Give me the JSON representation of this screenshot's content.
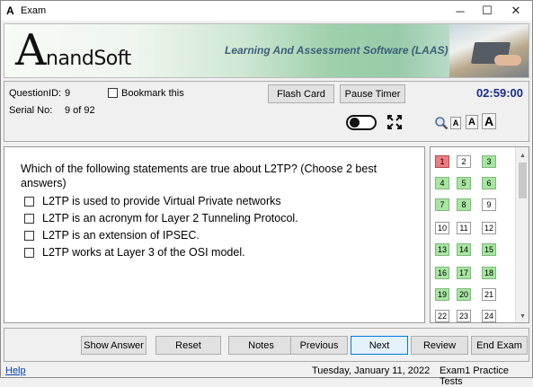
{
  "window": {
    "title": "Exam",
    "app_icon": "A",
    "controls": [
      "─",
      "☐",
      "✕"
    ]
  },
  "banner": {
    "logo_initial": "A",
    "logo_rest": "nandSoft",
    "tagline": "Learning And Assessment Software (LAAS)"
  },
  "info": {
    "question_id_label": "QuestionID:",
    "question_id": "9",
    "serial_label": "Serial No:",
    "serial": "9 of 92",
    "bookmark_label": "Bookmark this",
    "flash_card": "Flash Card",
    "pause_timer": "Pause Timer",
    "timer": "02:59:00",
    "font_sizes": [
      "A",
      "A",
      "A"
    ]
  },
  "question": {
    "text": "Which of the following statements are true about L2TP? (Choose 2 best answers)",
    "options": [
      "L2TP is used to provide Virtual Private networks",
      "L2TP is an acronym for Layer 2 Tunneling Protocol.",
      "L2TP is an extension of IPSEC.",
      "L2TP works at Layer 3 of the OSI model."
    ]
  },
  "grid": {
    "cells": [
      {
        "n": "1",
        "state": "current"
      },
      {
        "n": "2",
        "state": "none"
      },
      {
        "n": "3",
        "state": "correct"
      },
      {
        "n": "4",
        "state": "correct"
      },
      {
        "n": "5",
        "state": "correct"
      },
      {
        "n": "6",
        "state": "correct"
      },
      {
        "n": "7",
        "state": "correct"
      },
      {
        "n": "8",
        "state": "correct"
      },
      {
        "n": "9",
        "state": "none"
      },
      {
        "n": "10",
        "state": "none"
      },
      {
        "n": "11",
        "state": "none"
      },
      {
        "n": "12",
        "state": "none"
      },
      {
        "n": "13",
        "state": "correct"
      },
      {
        "n": "14",
        "state": "correct"
      },
      {
        "n": "15",
        "state": "correct"
      },
      {
        "n": "16",
        "state": "correct"
      },
      {
        "n": "17",
        "state": "correct"
      },
      {
        "n": "18",
        "state": "correct"
      },
      {
        "n": "19",
        "state": "correct"
      },
      {
        "n": "20",
        "state": "correct"
      },
      {
        "n": "21",
        "state": "none"
      },
      {
        "n": "22",
        "state": "none"
      },
      {
        "n": "23",
        "state": "none"
      },
      {
        "n": "24",
        "state": "none"
      }
    ],
    "scroll_up": "▲",
    "scroll_down": "▼"
  },
  "buttons": {
    "show_answer": "Show Answer",
    "reset": "Reset",
    "notes": "Notes",
    "previous": "Previous",
    "next": "Next",
    "review": "Review",
    "end_exam": "End Exam"
  },
  "status": {
    "help": "Help",
    "date": "Tuesday, January 11, 2022",
    "exam_name": "Exam1 Practice Tests"
  },
  "colors": {
    "timer": "#1a2c86",
    "correct": "#a7e6a1",
    "current": "#ef7b80",
    "primary_border": "#0078d7"
  }
}
